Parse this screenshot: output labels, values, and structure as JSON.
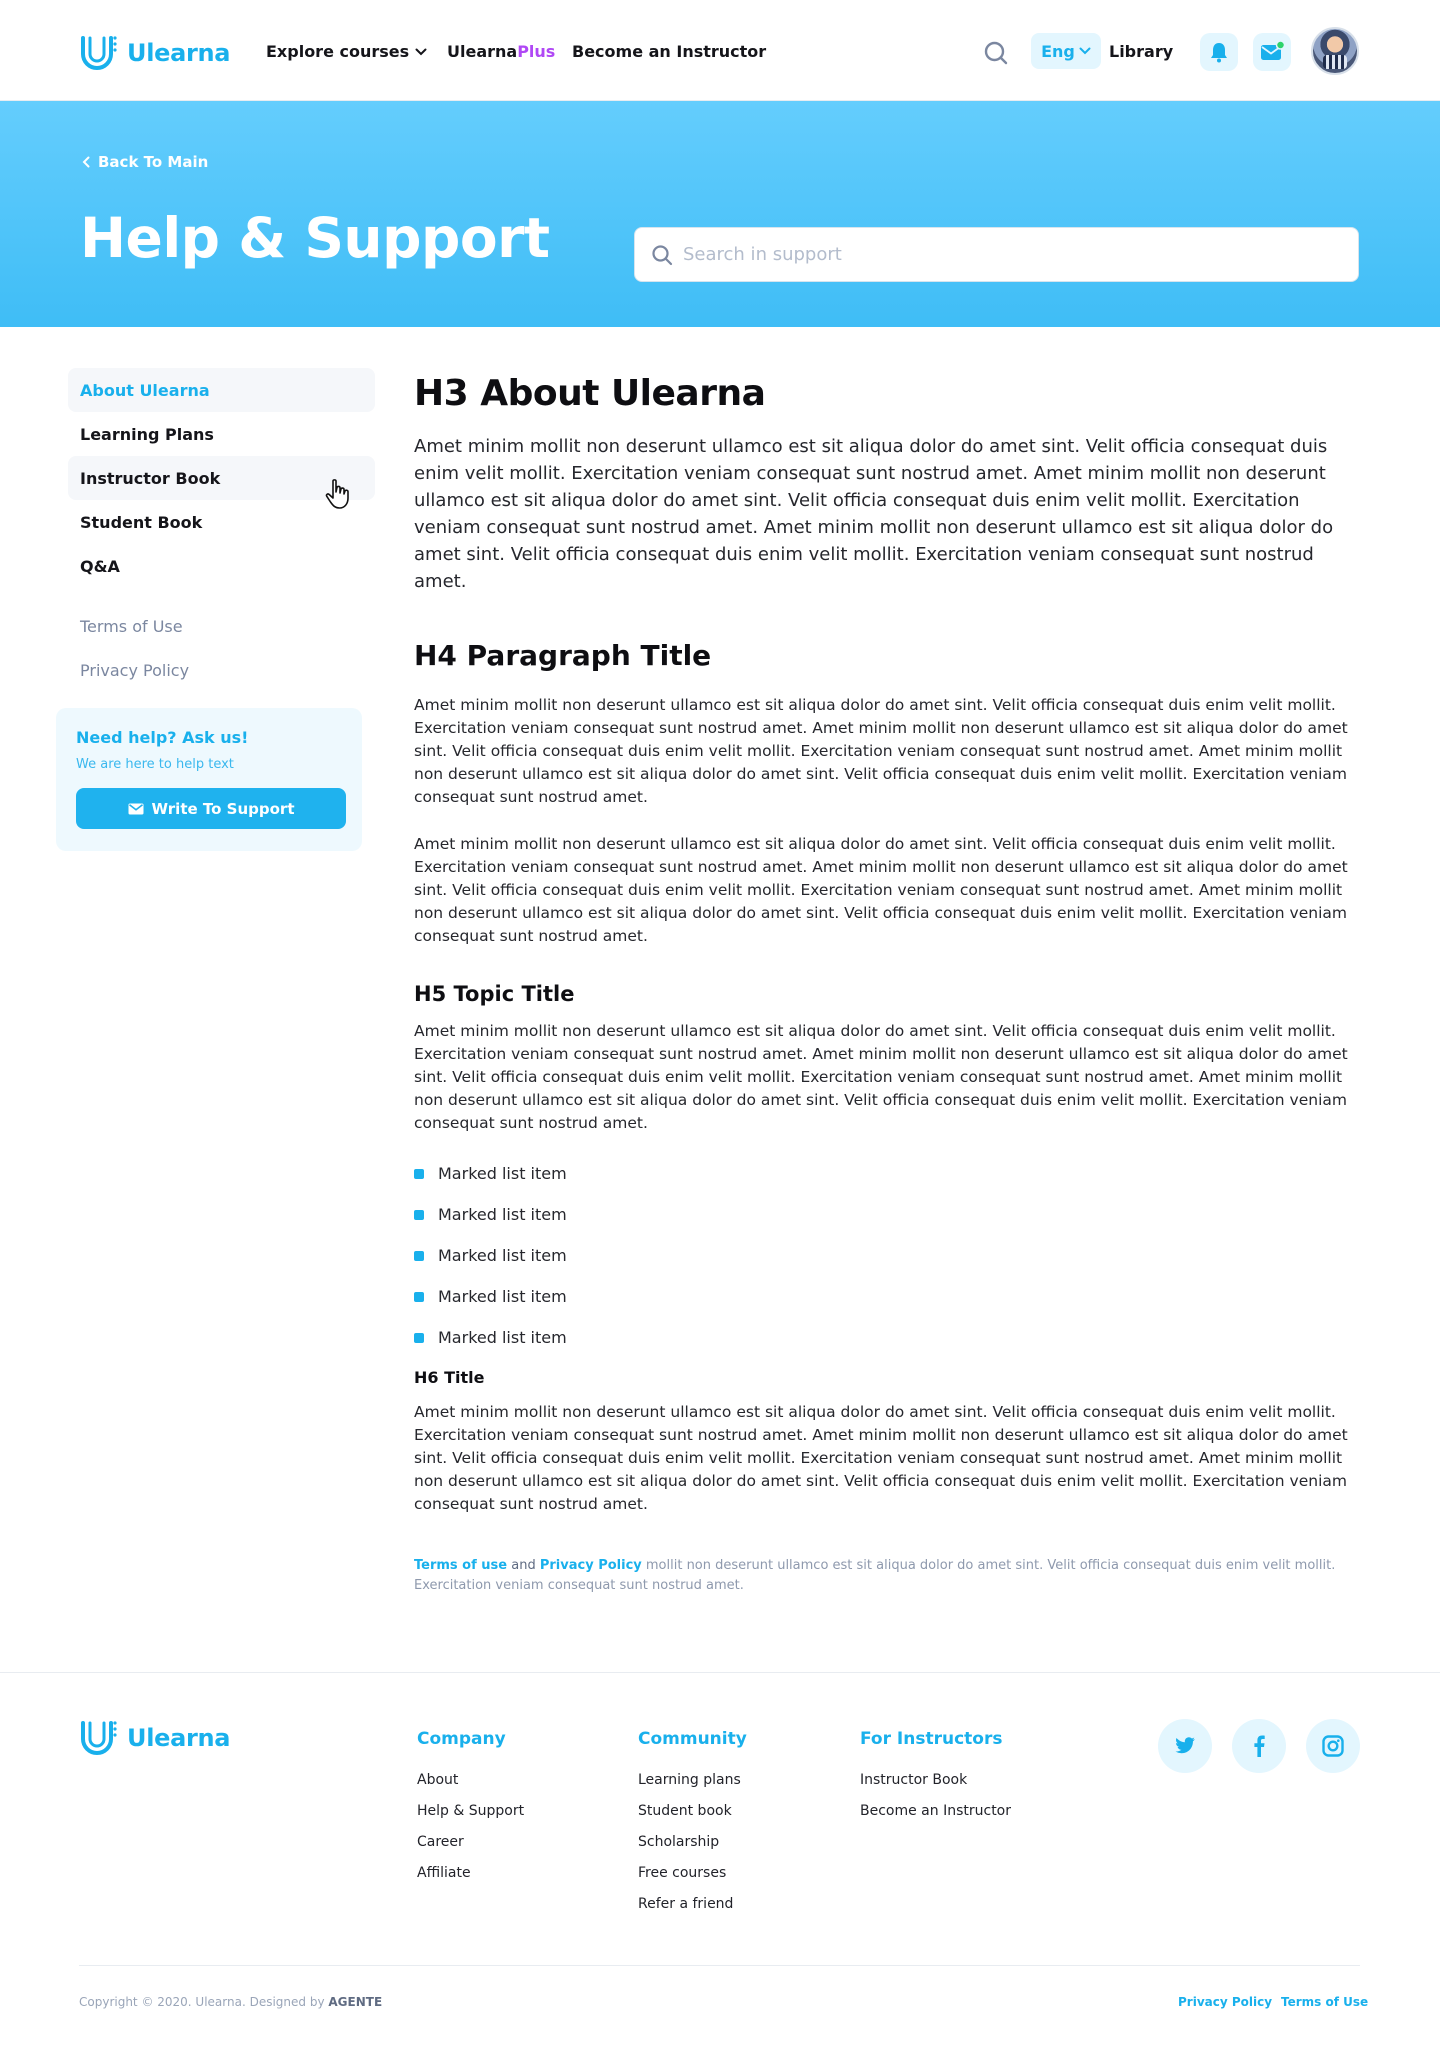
{
  "brand": {
    "name": "Ulearna",
    "color": "#19b0ec"
  },
  "header": {
    "nav": {
      "explore": "Explore courses",
      "plus_main": "Ulearna",
      "plus_suffix": "Plus",
      "instructor": "Become an Instructor"
    },
    "language": "Eng",
    "library": "Library",
    "icons": [
      "search-icon",
      "bell-icon",
      "mail-icon",
      "avatar"
    ]
  },
  "hero": {
    "back": "Back To Main",
    "title": "Help & Support",
    "search_placeholder": "Search in support"
  },
  "sidebar": {
    "items": [
      {
        "label": "About Ulearna",
        "active": true
      },
      {
        "label": "Learning Plans"
      },
      {
        "label": "Instructor Book",
        "hovered": true
      },
      {
        "label": "Student Book"
      },
      {
        "label": "Q&A"
      }
    ],
    "secondary": [
      {
        "label": "Terms of Use"
      },
      {
        "label": "Privacy Policy"
      }
    ],
    "help": {
      "title": "Need help? Ask us!",
      "text": "We are here to help text",
      "button": "Write To Support"
    }
  },
  "content": {
    "h3": "H3 About Ulearna",
    "lead": "Amet minim mollit non deserunt ullamco est sit aliqua dolor do amet sint. Velit officia consequat duis enim velit mollit. Exercitation veniam consequat sunt nostrud amet. Amet minim mollit non deserunt ullamco est sit aliqua dolor do amet sint. Velit officia consequat duis enim velit mollit. Exercitation veniam consequat sunt nostrud amet. Amet minim mollit non deserunt ullamco est sit aliqua dolor do amet sint. Velit officia consequat duis enim velit mollit. Exercitation veniam consequat sunt nostrud amet.",
    "h4": "H4 Paragraph Title",
    "p1": "Amet minim mollit non deserunt ullamco est sit aliqua dolor do amet sint. Velit officia consequat duis enim velit mollit. Exercitation veniam consequat sunt nostrud amet. Amet minim mollit non deserunt ullamco est sit aliqua dolor do amet sint. Velit officia consequat duis enim velit mollit. Exercitation veniam consequat sunt nostrud amet. Amet minim mollit non deserunt ullamco est sit aliqua dolor do amet sint. Velit officia consequat duis enim velit mollit. Exercitation veniam consequat sunt nostrud amet.",
    "p2": "Amet minim mollit non deserunt ullamco est sit aliqua dolor do amet sint. Velit officia consequat duis enim velit mollit. Exercitation veniam consequat sunt nostrud amet. Amet minim mollit non deserunt ullamco est sit aliqua dolor do amet sint. Velit officia consequat duis enim velit mollit. Exercitation veniam consequat sunt nostrud amet. Amet minim mollit non deserunt ullamco est sit aliqua dolor do amet sint. Velit officia consequat duis enim velit mollit. Exercitation veniam consequat sunt nostrud amet.",
    "h5": "H5 Topic Title",
    "p3": "Amet minim mollit non deserunt ullamco est sit aliqua dolor do amet sint. Velit officia consequat duis enim velit mollit. Exercitation veniam consequat sunt nostrud amet. Amet minim mollit non deserunt ullamco est sit aliqua dolor do amet sint. Velit officia consequat duis enim velit mollit. Exercitation veniam consequat sunt nostrud amet. Amet minim mollit non deserunt ullamco est sit aliqua dolor do amet sint. Velit officia consequat duis enim velit mollit. Exercitation veniam consequat sunt nostrud amet.",
    "list": [
      "Marked list item",
      "Marked list item",
      "Marked list item",
      "Marked list item",
      "Marked list item"
    ],
    "h6": "H6 Title",
    "p4": "Amet minim mollit non deserunt ullamco est sit aliqua dolor do amet sint. Velit officia consequat duis enim velit mollit. Exercitation veniam consequat sunt nostrud amet. Amet minim mollit non deserunt ullamco est sit aliqua dolor do amet sint. Velit officia consequat duis enim velit mollit. Exercitation veniam consequat sunt nostrud amet. Amet minim mollit non deserunt ullamco est sit aliqua dolor do amet sint. Velit officia consequat duis enim velit mollit. Exercitation veniam consequat sunt nostrud amet.",
    "note": {
      "terms": "Terms of use",
      "and": " and ",
      "privacy": "Privacy Policy",
      "rest": " mollit non deserunt ullamco est sit aliqua dolor do amet sint. Velit officia consequat duis enim velit mollit. Exercitation veniam consequat sunt nostrud amet."
    }
  },
  "footer": {
    "company": {
      "title": "Company",
      "links": [
        "About",
        "Help & Support",
        "Career",
        "Affiliate"
      ]
    },
    "community": {
      "title": "Community",
      "links": [
        "Learning plans",
        "Student book",
        "Scholarship",
        "Free courses",
        "Refer a friend"
      ]
    },
    "instructors": {
      "title": "For Instructors",
      "links": [
        "Instructor Book",
        "Become an Instructor"
      ]
    },
    "social": [
      "twitter-icon",
      "facebook-icon",
      "instagram-icon"
    ],
    "copyright_prefix": "Copyright © 2020. Ulearna. Designed by ",
    "copyright_designer": "AGENTE",
    "privacy": "Privacy Policy",
    "terms": "Terms of Use"
  }
}
